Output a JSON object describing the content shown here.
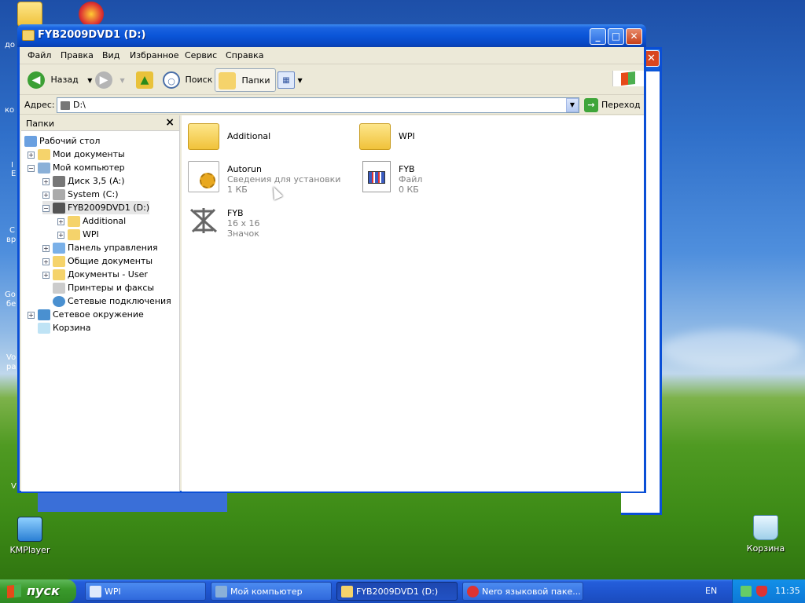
{
  "desktop": {
    "icons": [
      {
        "label": "KMPlayer",
        "icon": "kmplayer-icon"
      },
      {
        "label": "Корзина",
        "icon": "recycle-bin-icon"
      }
    ],
    "edge_fragments": [
      "до",
      "ко",
      "I",
      "E",
      "С",
      "вр",
      "Go",
      "бе",
      "Vo",
      "ра",
      "V"
    ]
  },
  "window": {
    "title": "FYB2009DVD1 (D:)",
    "menu": [
      "Файл",
      "Правка",
      "Вид",
      "Избранное",
      "Сервис",
      "Справка"
    ],
    "toolbar": {
      "back": "Назад",
      "search": "Поиск",
      "folders": "Папки"
    },
    "address": {
      "label": "Адрес:",
      "value": "D:\\",
      "go": "Переход"
    },
    "folders_pane": {
      "title": "Папки",
      "tree": [
        {
          "label": "Рабочий стол"
        },
        {
          "label": "Мои документы"
        },
        {
          "label": "Мой компьютер"
        },
        {
          "label": "Диск 3,5 (A:)"
        },
        {
          "label": "System (C:)"
        },
        {
          "label": "FYB2009DVD1 (D:)"
        },
        {
          "label": "Additional"
        },
        {
          "label": "WPI"
        },
        {
          "label": "Панель управления"
        },
        {
          "label": "Общие документы"
        },
        {
          "label": "Документы - User"
        },
        {
          "label": "Принтеры и факсы"
        },
        {
          "label": "Сетевые подключения"
        },
        {
          "label": "Сетевое окружение"
        },
        {
          "label": "Корзина"
        }
      ]
    },
    "files": [
      {
        "name": "Additional",
        "line1": "",
        "line2": ""
      },
      {
        "name": "WPI",
        "line1": "",
        "line2": ""
      },
      {
        "name": "Autorun",
        "line1": "Сведения для установки",
        "line2": "1 КБ"
      },
      {
        "name": "FYB",
        "line1": "Файл",
        "line2": "0 КБ"
      },
      {
        "name": "FYB",
        "line1": "16 x 16",
        "line2": "Значок"
      }
    ]
  },
  "taskbar": {
    "start": "пуск",
    "tasks": [
      {
        "label": "WPI"
      },
      {
        "label": "Мой компьютер"
      },
      {
        "label": "FYB2009DVD1 (D:)"
      },
      {
        "label": "Nero языковой паке..."
      }
    ],
    "lang": "EN",
    "clock": "11:35"
  },
  "colors": {
    "title_blue": "#0a55d8",
    "taskbar_blue": "#245edb",
    "start_green": "#3a9a2c"
  }
}
